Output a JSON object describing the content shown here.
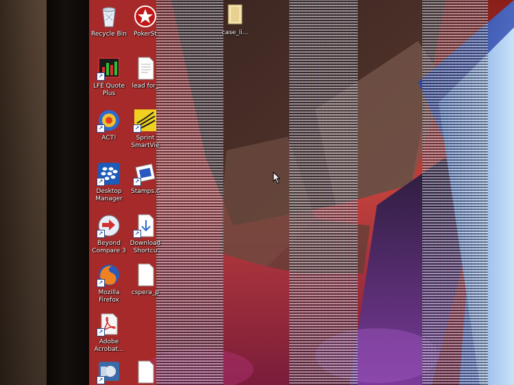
{
  "desktop": {
    "icons": [
      {
        "name": "recycle-bin",
        "label": "Recycle Bin",
        "icon": "recycle-bin-icon"
      },
      {
        "name": "pokerstars",
        "label": "PokerSt",
        "icon": "pokerstars-icon"
      },
      {
        "name": "lfe-quote-plus",
        "label": "LFE Quote",
        "label2": "Plus",
        "icon": "chart-app-icon"
      },
      {
        "name": "lead-for",
        "label": "lead for_",
        "icon": "document-icon"
      },
      {
        "name": "act",
        "label": "ACT!",
        "icon": "act-icon"
      },
      {
        "name": "sprint-smartview",
        "label": "Sprint",
        "label2": "SmartVie",
        "icon": "sprint-icon"
      },
      {
        "name": "desktop-manager",
        "label": "Desktop",
        "label2": "Manager",
        "icon": "blackberry-icon"
      },
      {
        "name": "stamps-com",
        "label": "Stamps.c",
        "icon": "stamps-icon"
      },
      {
        "name": "beyond-compare-3",
        "label": "Beyond",
        "label2": "Compare 3",
        "icon": "compare-icon"
      },
      {
        "name": "download-shortcut",
        "label": "Download",
        "label2": "Shortcu",
        "icon": "download-icon"
      },
      {
        "name": "mozilla-firefox",
        "label": "Mozilla",
        "label2": "Firefox",
        "icon": "firefox-icon"
      },
      {
        "name": "cspera-file",
        "label": "cspera_p",
        "icon": "document-icon"
      },
      {
        "name": "adobe-acrobat",
        "label": "Adobe",
        "label2": "Acrobat...",
        "icon": "acrobat-icon"
      },
      {
        "name": "utility-app",
        "label": "",
        "icon": "utility-icon"
      },
      {
        "name": "blank-file",
        "label": "",
        "icon": "document-icon"
      },
      {
        "name": "case-file",
        "label": "case_li...",
        "icon": "folder-icon"
      }
    ]
  },
  "colors": {
    "wallpaper_red": "#b02a2a",
    "wallpaper_blue": "#3a5fc8",
    "wallpaper_sky": "#8fb8e8"
  },
  "cursor": {
    "icon": "mouse-pointer-icon"
  }
}
